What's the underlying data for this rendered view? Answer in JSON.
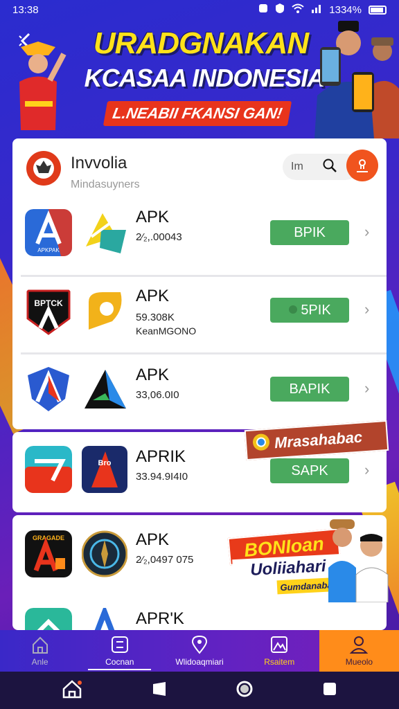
{
  "status": {
    "time": "13:38",
    "battery": "1334%"
  },
  "banner": {
    "headline": "URADGNAKAN",
    "subheadline": "KCASAA INDONESIA",
    "ribbon": "L.NEABII FKANSI GAN!"
  },
  "store": {
    "name": "Invvolia",
    "subtitle": "Mindasuyners",
    "search_value": "Im"
  },
  "apps": [
    {
      "title": "APK",
      "size": "2⁄₂,.00043",
      "extra": "",
      "button": "BPIK",
      "logo_text": "APKPAK"
    },
    {
      "title": "APK",
      "size": "59.308K",
      "extra": "KeanMGONO",
      "button": "5PIK",
      "logo_text": "BPTCK"
    },
    {
      "title": "APK",
      "size": "33,06.0I0",
      "extra": "",
      "button": "BAPIK",
      "logo_text": ""
    },
    {
      "title": "APRIK",
      "size": "33.94.9I4I0",
      "extra": "",
      "button": "SAPK",
      "logo_text": "Bro"
    },
    {
      "title": "APK",
      "size": "2⁄₂,0497 075",
      "extra": "",
      "button": "",
      "logo_text": "GRAGADE"
    },
    {
      "title": "APR'K",
      "size": "",
      "extra": "",
      "button": "",
      "logo_text": ""
    }
  ],
  "promos": {
    "badge": "Mrasahabac",
    "line1": "BONIoan",
    "line2": "Uoliiahari",
    "line3": "Gumdanabau"
  },
  "tabs": [
    {
      "label": "Anle"
    },
    {
      "label": "Cocnan"
    },
    {
      "label": "Wlidoaqmiari"
    },
    {
      "label": "Rsaitem"
    },
    {
      "label": "Mueolo"
    }
  ],
  "colors": {
    "accent": "#ff8c1a",
    "install_green": "#4aa95e",
    "store_red": "#e03a1a"
  }
}
